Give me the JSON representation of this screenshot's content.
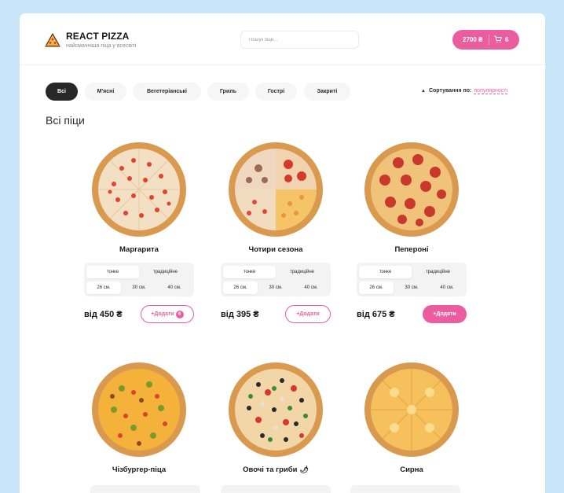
{
  "header": {
    "brand": "REACT PIZZA",
    "tagline": "найсмачніша піца у всесвіті",
    "search_placeholder": "Пошук піци...",
    "cart_total": "2700 ₴",
    "cart_count": "6"
  },
  "categories": [
    "Всі",
    "М'ясні",
    "Вегетеріанські",
    "Гриль",
    "Гострі",
    "Закриті"
  ],
  "active_category": "Всі",
  "sort": {
    "label": "Сортування по:",
    "value": "популярності"
  },
  "page_title": "Всі піци",
  "types": [
    "тонке",
    "традиційне"
  ],
  "sizes": [
    "26 см.",
    "30 см.",
    "40 см."
  ],
  "add_label": "Додати",
  "pizzas": [
    {
      "name": "Маргарита",
      "price": "від 450 ₴",
      "added": "6"
    },
    {
      "name": "Чотири сезона",
      "price": "від 395 ₴",
      "added": ""
    },
    {
      "name": "Пепероні",
      "price": "від 675 ₴",
      "added": ""
    },
    {
      "name": "Чізбургер-піца",
      "price": "",
      "added": ""
    },
    {
      "name": "Овочі та гриби",
      "price": "",
      "added": ""
    },
    {
      "name": "Сирна",
      "price": "",
      "added": ""
    }
  ],
  "colors": {
    "accent": "#ec5d9f",
    "background": "#c9e6f8",
    "dark": "#282828"
  },
  "icons": {
    "logo": "pizza-slice-icon",
    "cart": "cart-icon",
    "sort": "caret-up-icon",
    "veg": "pepper-icon"
  }
}
